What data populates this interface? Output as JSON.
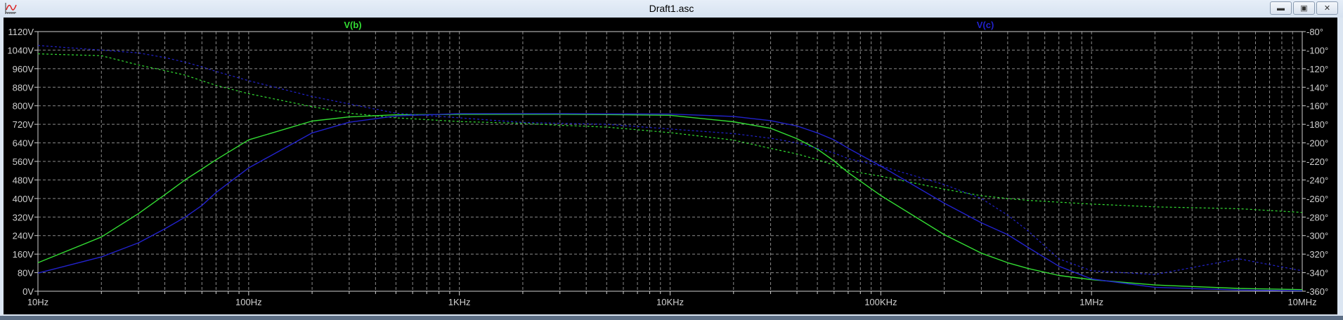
{
  "window": {
    "title": "Draft1.asc",
    "icon": "waveform-viewer-icon",
    "buttons": [
      "minimize",
      "restore",
      "close"
    ]
  },
  "chart_data": {
    "type": "line",
    "title": "",
    "xlabel": "",
    "ylabel": "",
    "y2label": "",
    "xscale": "log",
    "xlim": [
      10,
      10000000
    ],
    "ylim": [
      0,
      1120
    ],
    "y2lim": [
      -360,
      -80
    ],
    "grid": true,
    "x_ticks": [
      10,
      100,
      1000,
      10000,
      100000,
      1000000,
      10000000
    ],
    "x_tick_labels": [
      "10Hz",
      "100Hz",
      "1KHz",
      "10KHz",
      "100KHz",
      "1MHz",
      "10MHz"
    ],
    "y_tick_labels": [
      "0V",
      "80V",
      "160V",
      "240V",
      "320V",
      "400V",
      "480V",
      "560V",
      "640V",
      "720V",
      "800V",
      "880V",
      "960V",
      "1040V",
      "1120V"
    ],
    "y2_tick_labels": [
      "-360°",
      "-340°",
      "-320°",
      "-300°",
      "-280°",
      "-260°",
      "-240°",
      "-220°",
      "-200°",
      "-180°",
      "-160°",
      "-140°",
      "-120°",
      "-100°",
      "-80°"
    ],
    "x": [
      10,
      20,
      30,
      40,
      50,
      60,
      70,
      100,
      200,
      300,
      500,
      1000,
      2000,
      3000,
      5000,
      10000,
      20000,
      30000,
      40000,
      50000,
      60000,
      70000,
      100000,
      200000,
      300000,
      400000,
      500000,
      700000,
      1000000,
      2000000,
      5000000,
      10000000
    ],
    "series": [
      {
        "name": "V(b)",
        "color": "#33dd33",
        "quantity": "magnitude",
        "axis": "left",
        "style": "solid",
        "values": [
          123,
          234,
          335,
          416,
          481,
          527,
          567,
          653,
          734,
          752,
          761,
          763,
          763,
          763,
          762,
          759,
          731,
          703,
          658,
          613,
          562,
          512,
          413,
          244,
          164,
          123,
          98,
          68,
          50,
          27,
          12,
          7
        ]
      },
      {
        "name": "V(b)",
        "color": "#33dd33",
        "quantity": "phase",
        "axis": "right",
        "style": "dashed",
        "values": [
          -104,
          -106,
          -116,
          -122,
          -127,
          -133,
          -138,
          -147,
          -161,
          -168,
          -173,
          -177,
          -179,
          -181,
          -183,
          -189,
          -197,
          -206,
          -212,
          -218,
          -224,
          -230,
          -236,
          -250,
          -257,
          -260,
          -262,
          -264,
          -266,
          -269,
          -271,
          -275
        ]
      },
      {
        "name": "V(c)",
        "color": "#2222cc",
        "quantity": "magnitude",
        "axis": "left",
        "style": "solid",
        "values": [
          78,
          148,
          209,
          269,
          320,
          370,
          426,
          532,
          683,
          729,
          756,
          766,
          766,
          766,
          765,
          764,
          754,
          736,
          713,
          683,
          653,
          617,
          540,
          380,
          295,
          244,
          189,
          108,
          53,
          17,
          5,
          2
        ]
      },
      {
        "name": "V(c)",
        "color": "#2222cc",
        "quantity": "phase",
        "axis": "right",
        "style": "dashed",
        "values": [
          -95,
          -100,
          -103,
          -108,
          -113,
          -118,
          -123,
          -133,
          -150,
          -158,
          -168,
          -173,
          -178,
          -179,
          -180,
          -185,
          -190,
          -195,
          -200,
          -206,
          -211,
          -217,
          -225,
          -245,
          -260,
          -278,
          -295,
          -325,
          -338,
          -342,
          -325,
          -338
        ]
      }
    ],
    "legend": [
      {
        "label": "V(b)",
        "color": "#33dd33",
        "placement": "top-left"
      },
      {
        "label": "V(c)",
        "color": "#2222cc",
        "placement": "top-right"
      }
    ]
  }
}
